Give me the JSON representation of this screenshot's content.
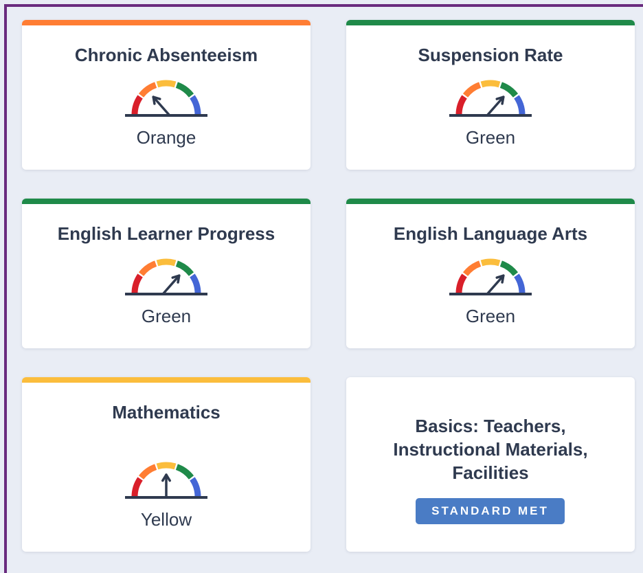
{
  "colors": {
    "orange": "#ff7d33",
    "green": "#1f8a49",
    "yellow": "#fbbd3c",
    "red": "#d91f2a",
    "blue": "#4466d6",
    "frame": "#6a2c7f",
    "badge": "#4a7cc5"
  },
  "cards": [
    {
      "title": "Chronic Absenteeism",
      "status": "Orange",
      "level": "orange",
      "bar_color": "#ff7d33"
    },
    {
      "title": "Suspension Rate",
      "status": "Green",
      "level": "green",
      "bar_color": "#1f8a49"
    },
    {
      "title": "English Learner Progress",
      "status": "Green",
      "level": "green",
      "bar_color": "#1f8a49"
    },
    {
      "title": "English Language Arts",
      "status": "Green",
      "level": "green",
      "bar_color": "#1f8a49"
    },
    {
      "title": "Mathematics",
      "status": "Yellow",
      "level": "yellow",
      "bar_color": "#fbbd3c"
    }
  ],
  "basics": {
    "title_lines": [
      "Basics: Teachers,",
      "Instructional Materials,",
      "Facilities"
    ],
    "badge": "STANDARD MET"
  },
  "gauge_levels": [
    "red",
    "orange",
    "yellow",
    "green",
    "blue"
  ]
}
